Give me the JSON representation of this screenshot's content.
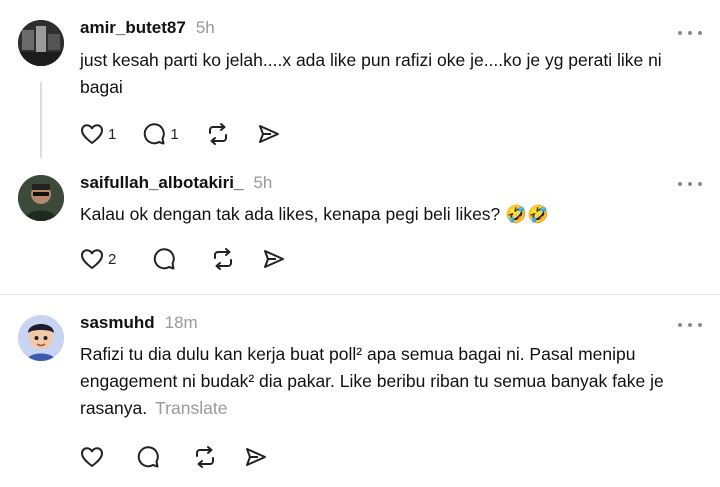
{
  "posts": [
    {
      "username": "amir_butet87",
      "time": "5h",
      "text": "just kesah parti ko jelah....x ada like pun rafizi oke je....ko je yg perati like ni bagai",
      "likes": "1",
      "replies": "1",
      "more_icon": "more-icon"
    },
    {
      "username": "saifullah_albotakiri_",
      "time": "5h",
      "text": "Kalau ok dengan tak ada likes, kenapa pegi beli likes? 🤣🤣",
      "likes": "2",
      "replies": "",
      "more_icon": "more-icon"
    },
    {
      "username": "sasmuhd",
      "time": "18m",
      "text": "Rafizi tu dia dulu kan kerja buat poll² apa semua bagai ni. Pasal menipu engagement ni budak² dia pakar. Like beribu riban tu semua banyak fake je rasanya.",
      "translate": "Translate",
      "likes": "",
      "replies": "",
      "more_icon": "more-icon"
    }
  ],
  "icons": {
    "like": "heart-icon",
    "reply": "comment-icon",
    "repost": "repost-icon",
    "share": "send-icon"
  }
}
